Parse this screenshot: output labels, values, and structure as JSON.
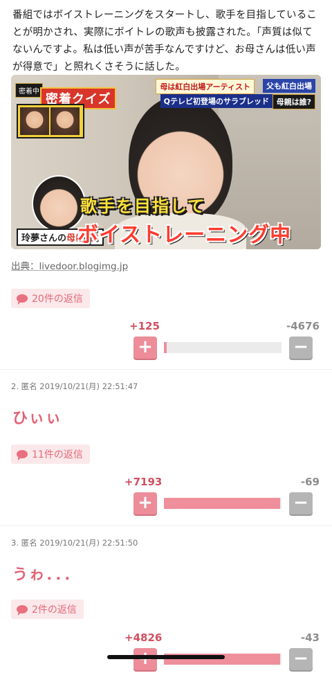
{
  "article": {
    "intro_text": "番組ではボイストレーニングをスタートし、歌手を目指していることが明かされ、実際にボイトレの歌声も披露された。「声質は似てないんですよ。私は低い声が苦手なんですけど、お母さんは低い声が得意で」と照れくさそうに話した。",
    "source_label": "出典：livedoor.blogimg.jp"
  },
  "image": {
    "badge": "密着中",
    "quiz_title": "密着クイズ",
    "caption_mother": "母は紅白出場アーティスト",
    "caption_father": "父も紅白出場",
    "caption_question": "Qテレビ初登場のサラブレッド",
    "caption_who": "母親は誰?",
    "whois_name": "玲夢さんの",
    "whois_em": "母は誰?",
    "telop_line1": "歌手を目指して",
    "telop_line2": "ボイストレーニング中"
  },
  "comments": [
    {
      "replies_label": "20件の返信",
      "plus": "+125",
      "minus": "-4676",
      "plus_ratio": 0.026
    },
    {
      "meta": "2. 匿名 2019/10/21(月) 22:51:47",
      "text": "ひぃぃ",
      "replies_label": "11件の返信",
      "plus": "+7193",
      "minus": "-69",
      "plus_ratio": 0.99
    },
    {
      "meta": "3. 匿名 2019/10/21(月) 22:51:50",
      "text": "うゎ．．．",
      "replies_label": "2件の返信",
      "plus": "+4826",
      "minus": "-43",
      "plus_ratio": 0.99
    }
  ],
  "buttons": {
    "plus_symbol": "+",
    "minus_symbol": "−"
  },
  "colors": {
    "accent_pink": "#e26375",
    "bar_fill": "#ee8f9b",
    "minus_gray": "#b5b5b5"
  }
}
